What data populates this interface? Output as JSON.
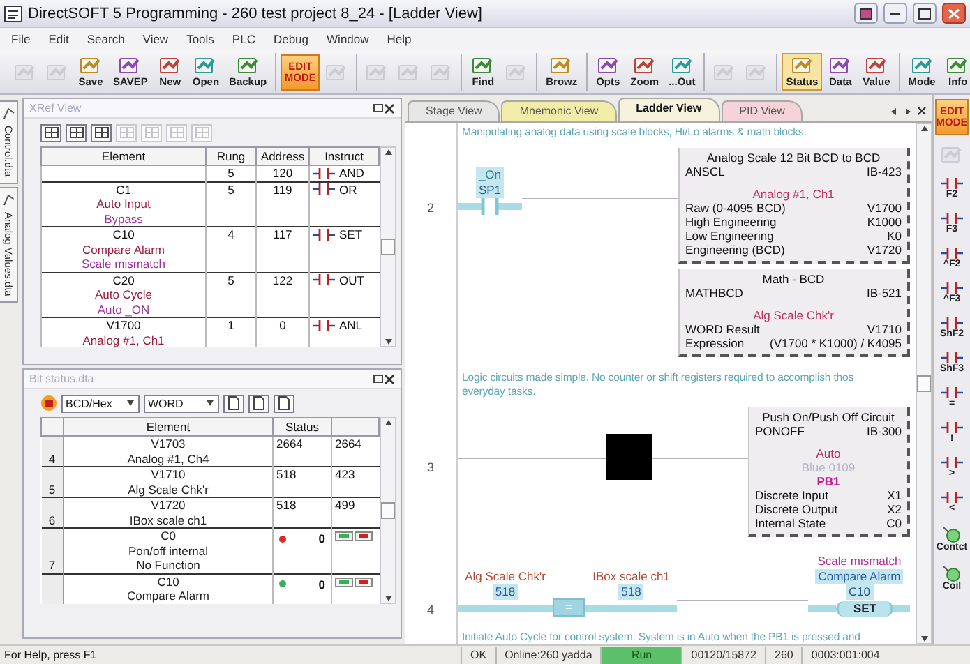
{
  "window": {
    "title": "DirectSOFT 5 Programming - 260 test project 8_24 - [Ladder View]"
  },
  "menu": [
    "File",
    "Edit",
    "Search",
    "View",
    "Tools",
    "PLC",
    "Debug",
    "Window",
    "Help"
  ],
  "toolbar": [
    {
      "items": [
        {
          "kind": "icon",
          "disabled": true
        },
        {
          "kind": "icon",
          "disabled": true
        },
        {
          "kind": "button",
          "label": "Save",
          "selected": false
        },
        {
          "kind": "button",
          "label": "SAVEP",
          "selected": false
        },
        {
          "kind": "button",
          "label": "New",
          "selected": false
        },
        {
          "kind": "button",
          "label": "Open",
          "selected": false
        },
        {
          "kind": "button",
          "label": "Backup",
          "selected": false
        }
      ]
    },
    {
      "items": [
        {
          "kind": "mode",
          "label": "EDIT MODE"
        },
        {
          "kind": "icon",
          "disabled": true
        }
      ]
    },
    {
      "items": [
        {
          "kind": "icon",
          "disabled": true
        },
        {
          "kind": "icon",
          "disabled": true
        },
        {
          "kind": "icon",
          "disabled": true
        }
      ]
    },
    {
      "items": [
        {
          "kind": "button",
          "label": "Find",
          "selected": false
        },
        {
          "kind": "icon",
          "disabled": true
        }
      ]
    },
    {
      "items": [
        {
          "kind": "button",
          "label": "Browz",
          "selected": false
        }
      ]
    },
    {
      "items": [
        {
          "kind": "button",
          "label": "Opts",
          "selected": false
        },
        {
          "kind": "button",
          "label": "Zoom",
          "selected": false
        },
        {
          "kind": "button",
          "label": "...Out",
          "selected": false
        }
      ]
    },
    {
      "items": [
        {
          "kind": "icon",
          "disabled": true
        },
        {
          "kind": "icon",
          "disabled": true
        }
      ]
    },
    {
      "items": [
        {
          "kind": "button",
          "label": "Status",
          "selected": true
        },
        {
          "kind": "button",
          "label": "Data",
          "selected": false
        },
        {
          "kind": "button",
          "label": "Value",
          "selected": false
        }
      ]
    },
    {
      "items": [
        {
          "kind": "button",
          "label": "Mode",
          "selected": false
        },
        {
          "kind": "button",
          "label": "Info",
          "selected": false
        }
      ]
    }
  ],
  "side_tabs": [
    {
      "label": "Control.dta"
    },
    {
      "label": "Analog Values.dta"
    }
  ],
  "xref": {
    "title": "XRef View",
    "columns": [
      "Element",
      "Rung",
      "Address",
      "Instruct"
    ],
    "rows": [
      {
        "lines": [],
        "rung": "5",
        "address": "120",
        "instruction": "AND"
      },
      {
        "lines": [
          {
            "text": "C1",
            "kind": "address"
          },
          {
            "text": "Auto Input",
            "kind": "nickname"
          },
          {
            "text": "Bypass",
            "kind": "description"
          }
        ],
        "rung": "5",
        "address": "119",
        "instruction": "OR"
      },
      {
        "lines": [
          {
            "text": "C10",
            "kind": "address"
          },
          {
            "text": "Compare Alarm",
            "kind": "nickname"
          },
          {
            "text": "Scale mismatch",
            "kind": "description"
          }
        ],
        "rung": "4",
        "address": "117",
        "instruction": "SET"
      },
      {
        "lines": [
          {
            "text": "C20",
            "kind": "address"
          },
          {
            "text": "Auto Cycle",
            "kind": "nickname"
          },
          {
            "text": "Auto _ON",
            "kind": "description"
          }
        ],
        "rung": "5",
        "address": "122",
        "instruction": "OUT"
      },
      {
        "lines": [
          {
            "text": "V1700",
            "kind": "address"
          },
          {
            "text": "Analog #1, Ch1",
            "kind": "nickname"
          }
        ],
        "rung": "1",
        "address": "0",
        "instruction": "ANL"
      }
    ]
  },
  "bit_status": {
    "title": "Bit status.dta",
    "format": "BCD/Hex",
    "size": "WORD",
    "columns": [
      "Element",
      "Status"
    ],
    "rows": [
      {
        "kind": "word",
        "number": "4",
        "lines": [
          "V1703",
          "Analog #1, Ch4"
        ],
        "status": "2664",
        "value": "2664"
      },
      {
        "kind": "word",
        "number": "5",
        "lines": [
          "V1710",
          "Alg Scale Chk'r"
        ],
        "status": "518",
        "value": "423"
      },
      {
        "kind": "word",
        "number": "6",
        "lines": [
          "V1720",
          "IBox scale ch1"
        ],
        "status": "518",
        "value": "499"
      },
      {
        "kind": "bit",
        "number": "7",
        "lines": [
          "C0",
          "Pon/off internal",
          "No Function"
        ],
        "color": "#e02828",
        "status": "0"
      },
      {
        "kind": "bit",
        "lines": [
          "C10",
          "Compare Alarm"
        ],
        "color": "#3cae5a",
        "status": "0"
      }
    ]
  },
  "view_tabs": [
    {
      "label": "Stage View",
      "color": "#e6e6e6",
      "selected": false
    },
    {
      "label": "Mnemonic View",
      "color": "#f3eca8",
      "selected": false
    },
    {
      "label": "Ladder View",
      "color": "#f6f2de",
      "selected": true
    },
    {
      "label": "PID View",
      "color": "#f5d3d8",
      "selected": false
    }
  ],
  "ladder": [
    {
      "kind": "comment",
      "lines": [
        "Manipulating analog data using scale blocks, Hi/Lo alarms & math blocks."
      ]
    },
    {
      "kind": "rung",
      "number": "2",
      "elements": [
        {
          "kind": "contact",
          "nickname": "_On",
          "address": "SP1",
          "powered": true
        },
        {
          "kind": "boxes",
          "boxes": [
            {
              "title": "Analog Scale 12 Bit BCD to BCD",
              "instruction": "ANSCL",
              "ib": "IB-423",
              "labels": [
                {
                  "text": "Analog #1, Ch1",
                  "kind": "nickname"
                }
              ],
              "params": [
                {
                  "name": "Raw (0-4095 BCD)",
                  "value": "V1700"
                },
                {
                  "name": "High Engineering",
                  "value": "K1000"
                },
                {
                  "name": "Low Engineering",
                  "value": "K0"
                },
                {
                  "name": "Engineering (BCD)",
                  "value": "V1720"
                }
              ]
            },
            {
              "title": "Math - BCD",
              "instruction": "MATHBCD",
              "ib": "IB-521",
              "labels": [
                {
                  "text": "Alg Scale Chk'r",
                  "kind": "nickname"
                }
              ],
              "params": [
                {
                  "name": "WORD Result",
                  "value": "V1710"
                },
                {
                  "name": "Expression",
                  "value": "(V1700 * K1000) / K4095"
                }
              ]
            }
          ]
        }
      ]
    },
    {
      "kind": "comment",
      "lines": [
        "Logic circuits made simple. No counter or shift registers required to accomplish thos",
        "everyday tasks."
      ]
    },
    {
      "kind": "rung",
      "number": "3",
      "elements": [
        {
          "kind": "block"
        },
        {
          "kind": "boxes",
          "boxes": [
            {
              "title": "Push On/Push Off Circuit",
              "instruction": "PONOFF",
              "ib": "IB-300",
              "labels": [
                {
                  "text": "Auto",
                  "kind": "nickname"
                },
                {
                  "text": "Blue 0109",
                  "kind": "description"
                },
                {
                  "text": "PB1",
                  "kind": "address"
                }
              ],
              "params": [
                {
                  "name": "Discrete Input",
                  "value": "X1"
                },
                {
                  "name": "Discrete Output",
                  "value": "X2"
                },
                {
                  "name": "Internal State",
                  "value": "C0"
                }
              ]
            }
          ]
        }
      ]
    },
    {
      "kind": "rung",
      "number": "4",
      "elements": [
        {
          "kind": "compare",
          "left": {
            "nickname": "Alg Scale Chk'r",
            "value": "518"
          },
          "operator": "=",
          "right": {
            "nickname": "IBox scale ch1",
            "value": "518"
          },
          "powered": true
        },
        {
          "kind": "coil",
          "description": "Scale mismatch",
          "nickname": "Compare Alarm",
          "address": "C10",
          "instruction": "SET",
          "powered": true
        }
      ]
    },
    {
      "kind": "comment",
      "lines": [
        "Initiate Auto Cycle for control system. System is in Auto when the PB1 is pressed and"
      ]
    }
  ],
  "instruction_bar": [
    {
      "kind": "mode",
      "label": "EDIT MODE"
    },
    {
      "kind": "icon",
      "disabled": true
    },
    {
      "kind": "contact",
      "label": "F2"
    },
    {
      "kind": "contact",
      "label": "F3"
    },
    {
      "kind": "contact",
      "label": "^F2"
    },
    {
      "kind": "contact",
      "label": "^F3"
    },
    {
      "kind": "contact",
      "label": "ShF2"
    },
    {
      "kind": "contact",
      "label": "ShF3"
    },
    {
      "kind": "contact",
      "label": "="
    },
    {
      "kind": "contact",
      "label": "!"
    },
    {
      "kind": "contact",
      "label": ">"
    },
    {
      "kind": "contact",
      "label": "<"
    },
    {
      "kind": "node",
      "label": "Contct"
    },
    {
      "kind": "node",
      "label": "Coil"
    }
  ],
  "status_bar": {
    "help": "For Help, press F1",
    "cells": [
      {
        "text": "OK",
        "kind": "text"
      },
      {
        "text": "Online:260 yadda",
        "kind": "text"
      },
      {
        "text": "Run",
        "kind": "run"
      },
      {
        "text": "00120/15872",
        "kind": "text"
      },
      {
        "text": "260",
        "kind": "text"
      },
      {
        "text": "0003:001:004",
        "kind": "text"
      }
    ]
  }
}
